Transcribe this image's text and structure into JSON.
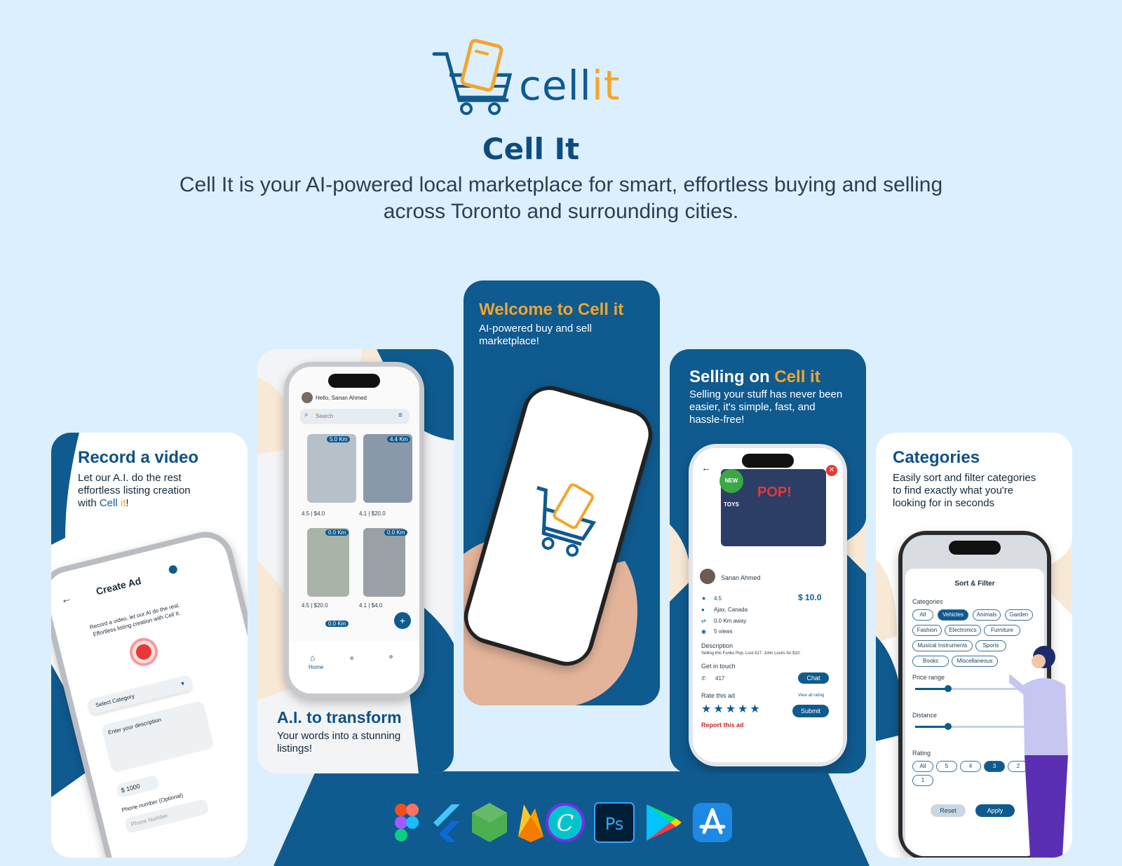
{
  "brand": {
    "logo_text_a": "cell",
    "logo_text_b": "it",
    "title": "Cell It",
    "tagline": "Cell It is your AI-powered local marketplace for smart, effortless buying and selling across Toronto and surrounding cities."
  },
  "colors": {
    "bg": "#dcefff",
    "navy": "#0f5a8f",
    "orange": "#f4a52b",
    "cream": "#f8e9d6"
  },
  "cards": {
    "record": {
      "head": "Record a video",
      "sub1": "Let our A.I. do the rest",
      "sub2": "effortless listing creation",
      "sub3a": "with ",
      "sub3b": "Cell ",
      "sub3c": "it",
      "sub3d": "!",
      "screen_title": "Create Ad",
      "hint": "Record a video, let our AI do the rest. Effortless listing creation with Cell It.",
      "select": "Select Category",
      "desc": "Enter your description",
      "price": "$ 1000",
      "phone_label": "Phone number (Optional)",
      "phone_ph": "Phone Number"
    },
    "transform": {
      "head": "A.I. to transform",
      "sub1": "Your words into a stunning",
      "sub2": "listings!",
      "hello": "Hello, Sanan Ahmed",
      "search": "Search",
      "home": "Home",
      "dist1": "5.0 Km",
      "dist2": "4.4 Km",
      "dist3": "0.0 Km",
      "dist4": "0.0 Km",
      "dist5": "0.0 Km",
      "p1": "4.5 | $4.0",
      "p2": "4.1 | $20.0",
      "p3": "4.5 | $20.0",
      "p4": "4.1 | $4.0"
    },
    "welcome": {
      "head_a": "Welcome to ",
      "head_b": "Cell it",
      "sub1": "AI-powered buy and sell",
      "sub2": "marketplace!"
    },
    "selling": {
      "head_a": "Selling on ",
      "head_b": "Cell it",
      "sub1": "Selling your stuff has never been",
      "sub2": "easier, it's simple, fast, and",
      "sub3": "hassle-free!",
      "seller": "Sanan Ahmed",
      "rating": "4.5",
      "price": "$ 10.0",
      "loc": "Ajax, Canada",
      "dist": "0.0 Km away",
      "views": "5 views",
      "desc_label": "Description",
      "desc": "Selling this Funko Pop. Lost 417. John Locks for $10.",
      "contact_label": "Get in touch",
      "phone": "417",
      "chat": "Chat",
      "rate_label": "Rate this ad",
      "view_rating": "View all rating",
      "submit": "Submit",
      "report": "Report this ad",
      "badge": "NEW TOYS",
      "pop": "POP!"
    },
    "categories": {
      "head": "Categories",
      "sub1": "Easily sort and filter categories",
      "sub2": "to find exactly what you're",
      "sub3": "looking for in seconds",
      "sheet_title": "Sort & Filter",
      "cat_label": "Categories",
      "cats": [
        "All",
        "Vehicles",
        "Animals",
        "Garden",
        "Fashion",
        "Electronics",
        "Furniture",
        "Musical Instruments",
        "Sports",
        "Books",
        "Miscellaneous"
      ],
      "price_label": "Price range",
      "dist_label": "Distance",
      "rating_label": "Rating",
      "ratings": [
        "All",
        "5",
        "4",
        "3",
        "2",
        "1"
      ],
      "reset": "Reset",
      "apply": "Apply"
    }
  },
  "tools": [
    "figma-icon",
    "flutter-icon",
    "nodejs-icon",
    "firebase-icon",
    "canva-icon",
    "photoshop-icon",
    "google-play-icon",
    "app-store-icon"
  ]
}
